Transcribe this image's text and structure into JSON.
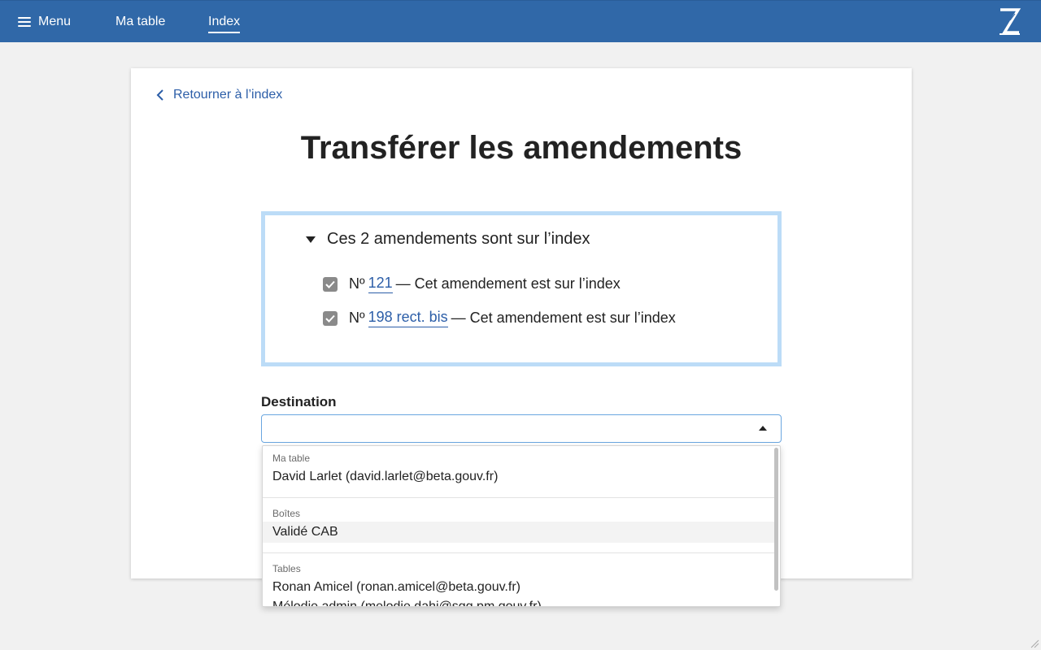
{
  "nav": {
    "menu_label": "Menu",
    "table_label": "Ma table",
    "index_label": "Index",
    "logo_icon": "z-logo"
  },
  "page": {
    "back_label": "Retourner à l’index",
    "title": "Transférer les amendements"
  },
  "selection": {
    "summary": "Ces 2 amendements sont sur l’index",
    "items": [
      {
        "prefix": "Nº",
        "number": "121",
        "suffix": "— Cet amendement est sur l’index",
        "checked": true
      },
      {
        "prefix": "Nº",
        "number": "198 rect. bis",
        "suffix": "— Cet amendement est sur l’index",
        "checked": true
      }
    ]
  },
  "destination": {
    "label": "Destination",
    "value": "",
    "groups": [
      {
        "label": "Ma table",
        "options": [
          "David Larlet (david.larlet@beta.gouv.fr)"
        ]
      },
      {
        "label": "Boîtes",
        "options": [
          "Validé CAB"
        ]
      },
      {
        "label": "Tables",
        "options": [
          "Ronan Amicel (ronan.amicel@beta.gouv.fr)",
          "Mélodie admin (melodie.dahi@sgg.pm.gouv.fr)"
        ]
      }
    ]
  },
  "colors": {
    "topbar": "#3068a8",
    "link": "#2c5ea8",
    "selection_border": "#bcdcf7"
  }
}
